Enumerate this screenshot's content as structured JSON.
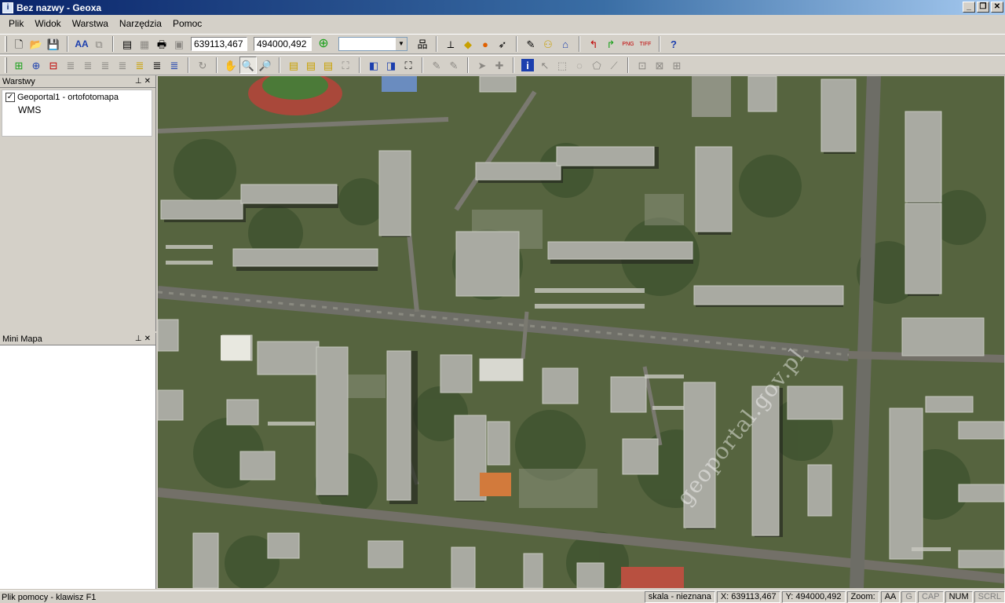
{
  "window": {
    "title": "Bez nazwy - Geoxa",
    "app_icon": "info-icon"
  },
  "menu": [
    "Plik",
    "Widok",
    "Warstwa",
    "Narzędzia",
    "Pomoc"
  ],
  "toolbar": {
    "coord_x": "639113,467",
    "coord_y": "494000,492",
    "scale_combo": ""
  },
  "layers_panel": {
    "title": "Warstwy",
    "layers": [
      {
        "name": "Geoportal1 - ortofotomapa",
        "checked": true,
        "type": "WMS"
      }
    ]
  },
  "minimap_panel": {
    "title": "Mini Mapa"
  },
  "map": {
    "watermark": "geoportal.gov.pl"
  },
  "statusbar": {
    "help": "Plik pomocy - klawisz F1",
    "scale": "skala - nieznana",
    "x": "X: 639113,467",
    "y": "Y: 494000,492",
    "zoom": "Zoom:",
    "aa": "AA",
    "g": "G",
    "cap": "CAP",
    "num": "NUM",
    "scrl": "SCRL"
  }
}
